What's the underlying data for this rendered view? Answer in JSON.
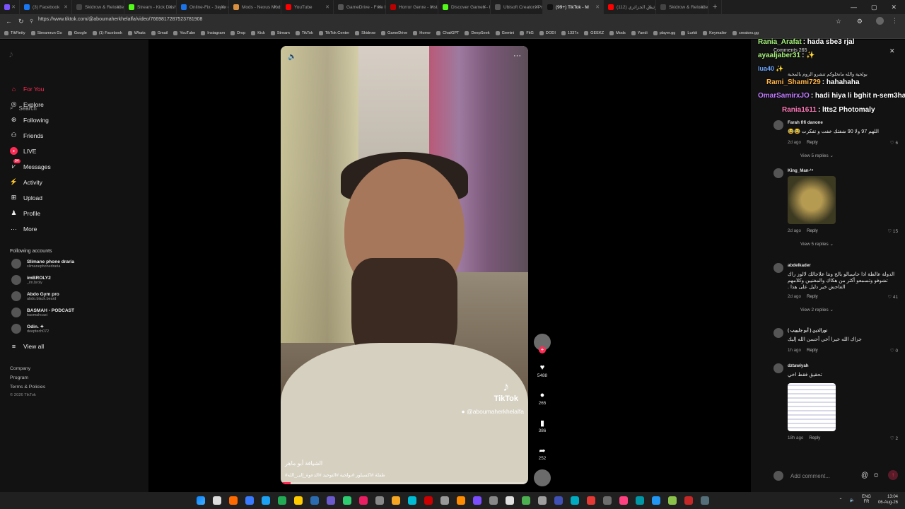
{
  "browser": {
    "url": "https://www.tiktok.com/@aboumaherkhelalfa/video/7669817287523781908",
    "tabs": [
      {
        "label": "",
        "color": "#7b52ff"
      },
      {
        "label": "(3) Facebook",
        "color": "#1877f2"
      },
      {
        "label": "Skidrow & Reloaded",
        "color": "#444"
      },
      {
        "label": "Stream - Kick Dashb",
        "color": "#53fc18"
      },
      {
        "label": "Online-Fix - Звуки с",
        "color": "#1a73e8"
      },
      {
        "label": "Mods - Nexus Mods",
        "color": "#d98f40"
      },
      {
        "label": "YouTube",
        "color": "#ff0000"
      },
      {
        "label": "GameDrive - Free Do",
        "color": "#555"
      },
      {
        "label": "Horror Genre - Insta",
        "color": "#b00"
      },
      {
        "label": "Discover Games - Ki",
        "color": "#53fc18"
      },
      {
        "label": "Ubisoft Creators Pro",
        "color": "#555"
      },
      {
        "label": "(99+) TikTok - M",
        "color": "#111"
      },
      {
        "label": "(112) الرئيس الجزائري",
        "color": "#ff0000"
      },
      {
        "label": "Skidrow & Reloaded",
        "color": "#444"
      }
    ],
    "bookmarks": [
      "TikFinity",
      "Streamrun Go",
      "Google",
      "(1) Facebook",
      "Whats",
      "Gmail",
      "YouTube",
      "Instagram",
      "Drop",
      "Kick",
      "Stream",
      "TikTok",
      "TikTok Center",
      "Skidrow",
      "GameDrive",
      "Horror",
      "ChatGPT",
      "DeepSeek",
      "Gemini",
      "FitG",
      "DODI",
      "1337x",
      "GEEKZ",
      "Mods",
      "Yandi",
      "player.gg",
      "Lurkit",
      "Keymailer",
      "creators.gg"
    ]
  },
  "sidebar": {
    "search_placeholder": "Search",
    "nav": [
      {
        "label": "For You",
        "icon": "home-icon",
        "glyph": "⌂",
        "active": true
      },
      {
        "label": "Explore",
        "icon": "compass-icon",
        "glyph": "◎",
        "active": false
      },
      {
        "label": "Following",
        "icon": "following-icon",
        "glyph": "⊛",
        "active": false
      },
      {
        "label": "Friends",
        "icon": "friends-icon",
        "glyph": "⚇",
        "active": false
      },
      {
        "label": "LIVE",
        "icon": "live-icon",
        "glyph": "●",
        "active": false
      },
      {
        "label": "Messages",
        "icon": "messages-icon",
        "glyph": "⩗",
        "active": false,
        "badge": "94"
      },
      {
        "label": "Activity",
        "icon": "activity-icon",
        "glyph": "⚡",
        "active": false
      },
      {
        "label": "Upload",
        "icon": "upload-icon",
        "glyph": "⊞",
        "active": false
      },
      {
        "label": "Profile",
        "icon": "profile-icon",
        "glyph": "♟",
        "active": false
      },
      {
        "label": "More",
        "icon": "more-icon",
        "glyph": "···",
        "active": false
      }
    ],
    "following_title": "Following accounts",
    "accounts": [
      {
        "name": "Slimane phone draria",
        "handle": "slimanephonedraria"
      },
      {
        "name": "imBROLY2",
        "handle": "_im.broly"
      },
      {
        "name": "Abdo Gym pro",
        "handle": "abdo.black.beard"
      },
      {
        "name": "BASMAH - PODCAST",
        "handle": "basmahcast"
      },
      {
        "name": "Odin. ✦",
        "handle": "deeptech072"
      }
    ],
    "view_all": "View all",
    "footer": [
      "Company",
      "Program",
      "Terms & Policies",
      "© 2026 TikTok"
    ]
  },
  "video": {
    "tiktok_word": "TikTok",
    "handle": "@aboumaherkhelalfa",
    "caption": "الشيافة أبو ماهر",
    "hashtags": "#طفلة #اكسبلور #بولحية #التوحيد #الدعوة_إلى_الله",
    "progress": 0.04
  },
  "actions": {
    "likes": "5488",
    "comments": "265",
    "saves": "386",
    "shares": "252"
  },
  "comments_panel": {
    "title": "Comments 265",
    "live_chat": [
      {
        "user": "Rania_Arafat",
        "text": ": hada sbe3 rjal",
        "color": "#a6f27a"
      },
      {
        "user": "ayaaljaber31",
        "text": ": ✨",
        "color": "#a6f27a"
      },
      {
        "user": "lua40",
        "text": "✨",
        "color": "#6fa8ff"
      },
      {
        "user": "Rami_Shami729",
        "text": ": hahahaha",
        "color": "#ffb347"
      },
      {
        "user": "OmarSamirxJO",
        "text": ": hadi hiya li bghit n-sem3ha",
        "color": "#c07bff"
      },
      {
        "user": "Rania1611",
        "text": ": ltts2 Photomaly",
        "color": "#ff7ab8"
      }
    ],
    "overlay_text": "بولحية والله مانخلوكم تتشرو الروم بالمحبة",
    "items": [
      {
        "name": "Farah fifi danone",
        "text": "اللهم 97 ولا 90 شفتك خفت و تفكرت 😂😂",
        "time": "2d ago",
        "reply": "Reply",
        "likes": "6",
        "replies": "View 5 replies"
      },
      {
        "name": "King_Man-¹⁶",
        "text": "",
        "time": "2d ago",
        "reply": "Reply",
        "likes": "15",
        "replies": "View 5 replies",
        "image": true
      },
      {
        "name": "abdelkader",
        "text": "الدولة عالطة اذا حاسبالو بالخ ونتا علاجالك لالوز راك تشوفو وتسمعو أكثر من هكاك والمغنيين وكلامهم الفاحش خير دليل على هذا .",
        "time": "2d ago",
        "reply": "Reply",
        "likes": "41",
        "replies": "View 2 replies"
      },
      {
        "name": "نورالدين ( أبو جليبيب )",
        "text": "جزاك الله خيرا أخي أحسن الله إليك",
        "time": "1h ago",
        "reply": "Reply",
        "likes": "0"
      },
      {
        "name": "dztawiyah",
        "text": "تحقيق فقط اخي",
        "time": "18h ago",
        "reply": "Reply",
        "likes": "2",
        "image": true
      }
    ],
    "add_comment_placeholder": "Add comment...",
    "close": "✕"
  },
  "taskbar": {
    "lang": "ENG",
    "region": "FR",
    "time": "13:04",
    "date": "06-Aug-26"
  },
  "colors": {
    "accent": "#fe2c55",
    "bg": "#121212",
    "chrome": "#2e2e2e"
  }
}
